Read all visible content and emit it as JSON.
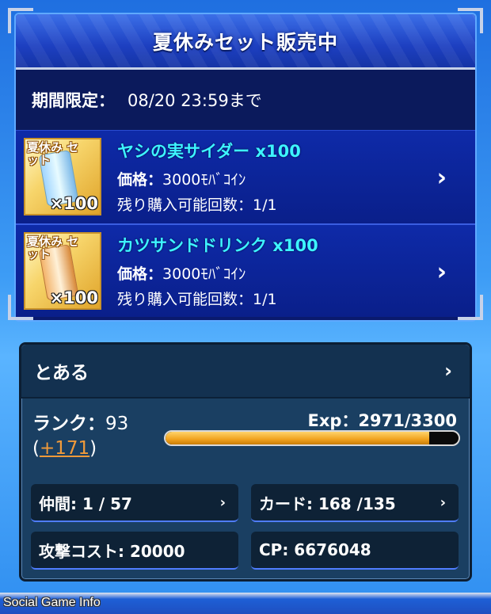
{
  "sale": {
    "title": "夏休みセット販売中",
    "limit_label": "期間限定：",
    "limit_value": "08/20 23:59まで",
    "items": [
      {
        "thumb_tag": "夏休み セット",
        "thumb_qty": "×100",
        "name": "ヤシの実サイダー x100",
        "price_label": "価格：",
        "price_value": "3000ﾓﾊﾞｺｲﾝ",
        "remaining_label": "残り購入可能回数：",
        "remaining_value": "1/1",
        "arrow": "›"
      },
      {
        "thumb_tag": "夏休み セット",
        "thumb_qty": "×100",
        "name": "カツサンドドリンク x100",
        "price_label": "価格：",
        "price_value": "3000ﾓﾊﾞｺｲﾝ",
        "remaining_label": "残り購入可能回数：",
        "remaining_value": "1/1",
        "arrow": "›"
      }
    ]
  },
  "profile": {
    "name": "とある",
    "chevron": "›",
    "rank_label": "ランク：",
    "rank_value": "93",
    "rank_bonus_open": "(",
    "rank_bonus": "+171",
    "rank_bonus_close": ")",
    "exp_text": "Exp：2971/3300",
    "exp_progress": 0.9,
    "stats": {
      "friends": "仲間: 1 / 57",
      "cards": "カード: 168 /135",
      "attack_cost": "攻撃コスト: 20000",
      "cp": "CP: 6676048",
      "chevron": "›"
    }
  },
  "watermark": "Social Game Info"
}
